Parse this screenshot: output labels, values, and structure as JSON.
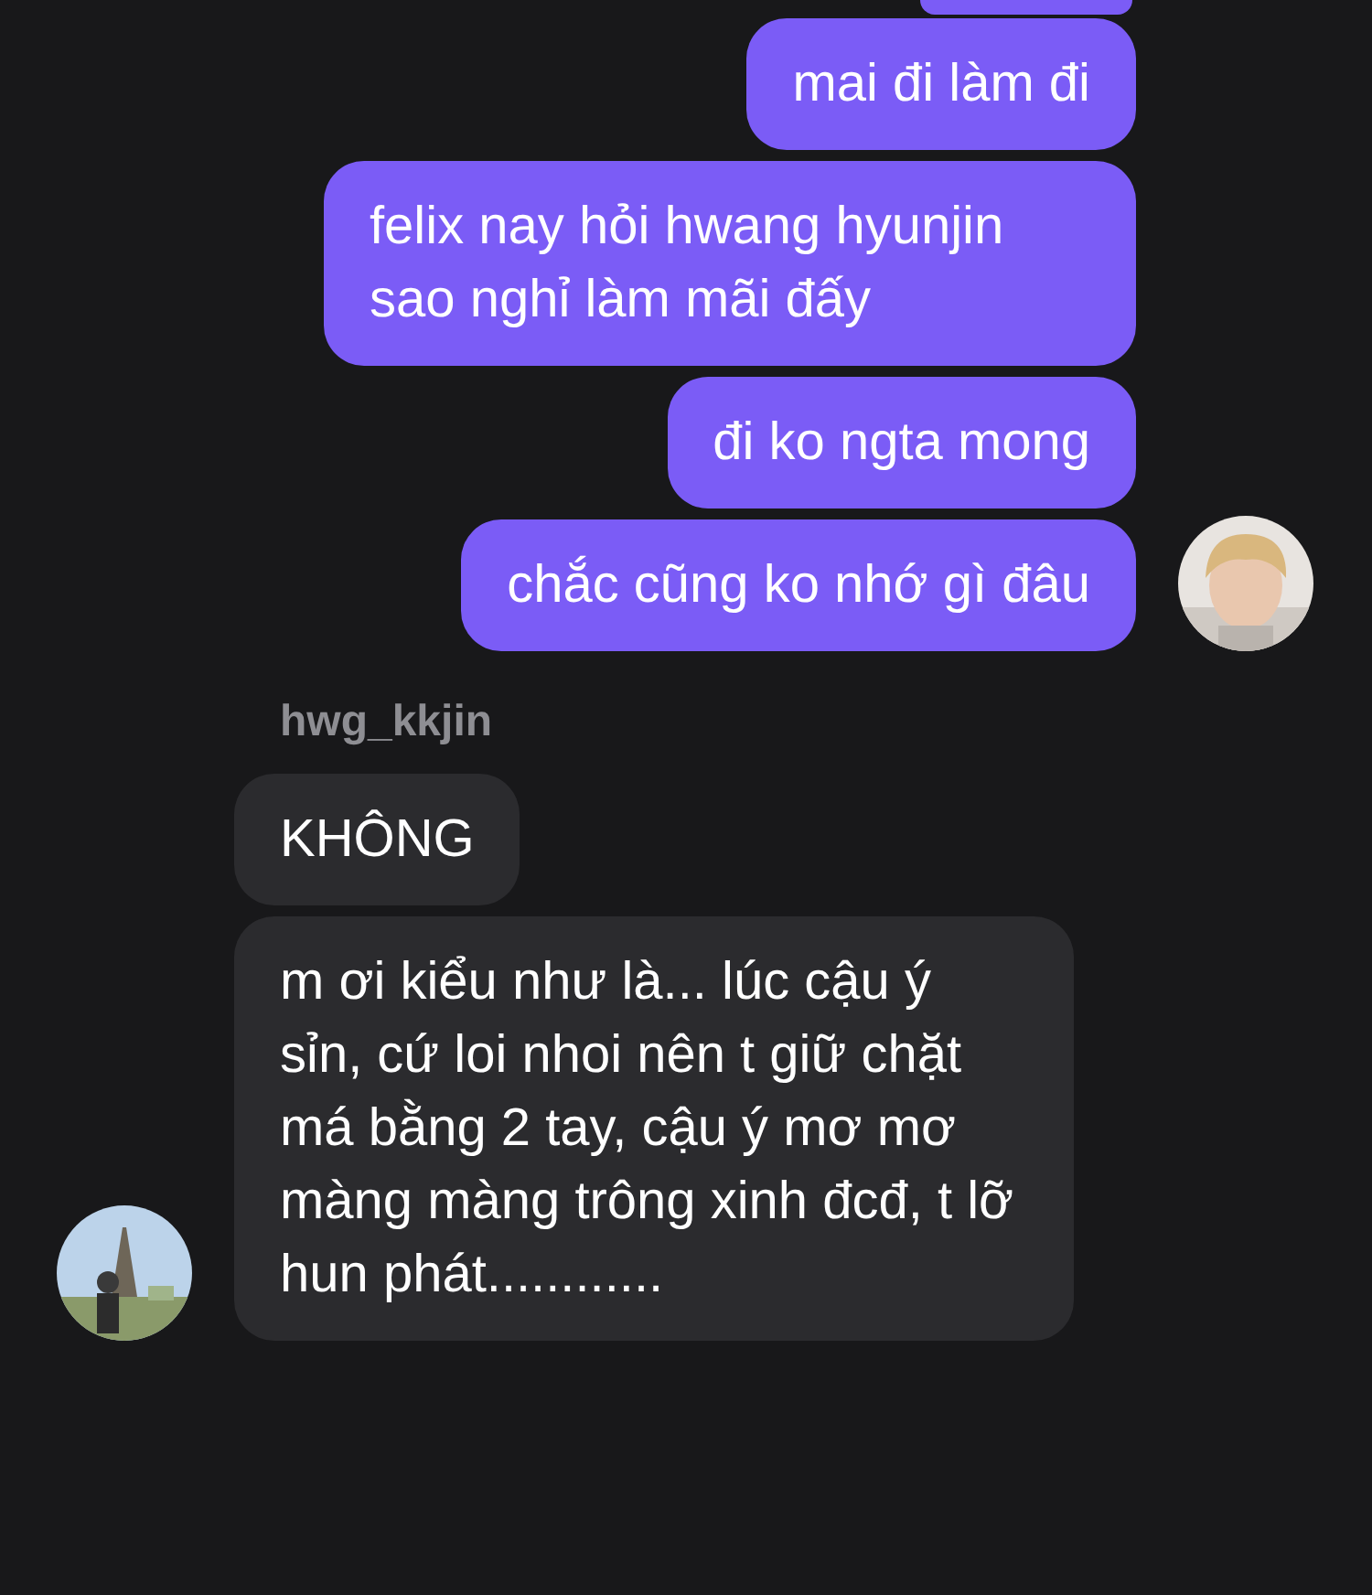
{
  "groups": [
    {
      "kind": "outgoing",
      "messages": [
        {
          "kind": "clipped"
        },
        {
          "kind": "text",
          "text": "mai đi làm đi"
        },
        {
          "kind": "text",
          "text": "felix nay hỏi hwang hyunjin sao nghỉ làm mãi đấy"
        },
        {
          "kind": "text",
          "text": "đi ko ngta mong"
        },
        {
          "kind": "text",
          "text": "chắc cũng ko nhớ gì đâu"
        }
      ]
    },
    {
      "kind": "incoming",
      "sender": "hwg_kkjin",
      "messages": [
        {
          "kind": "text",
          "text": "KHÔNG"
        },
        {
          "kind": "text",
          "text": "m ơi kiểu như là... lúc cậu ý sỉn, cứ loi nhoi nên t giữ chặt má bằng 2 tay, cậu ý mơ mơ màng màng trông xinh đcđ, t lỡ hun phát............"
        }
      ]
    }
  ]
}
